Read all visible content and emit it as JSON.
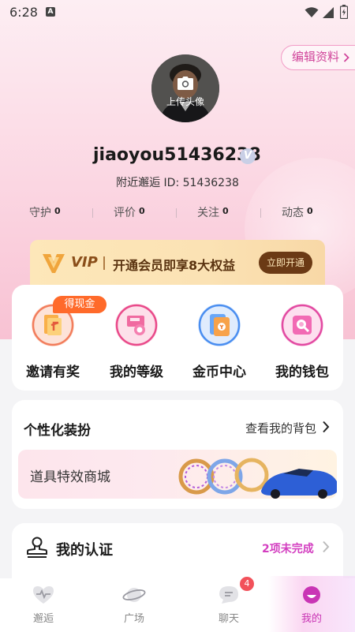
{
  "status_bar": {
    "time": "6:28",
    "app_badge": "A"
  },
  "header": {
    "edit_profile_label": "编辑资料"
  },
  "profile": {
    "avatar_label": "上传头像",
    "username": "jiaoyou51436238",
    "verified_badge": "V",
    "id_line": "附近邂逅 ID: 51436238"
  },
  "stats": [
    {
      "label": "守护",
      "value": "0"
    },
    {
      "label": "评价",
      "value": "0"
    },
    {
      "label": "关注",
      "value": "0"
    },
    {
      "label": "动态",
      "value": "0"
    }
  ],
  "vip": {
    "badge": "VIP",
    "description": "开通会员即享8大权益",
    "button": "立即开通"
  },
  "features": {
    "cash_tag": "得现金",
    "items": [
      {
        "label": "邀请有奖",
        "icon": "invite-gift-icon"
      },
      {
        "label": "我的等级",
        "icon": "level-medal-icon"
      },
      {
        "label": "金币中心",
        "icon": "coin-wallet-icon"
      },
      {
        "label": "我的钱包",
        "icon": "wallet-search-icon"
      }
    ]
  },
  "dressup": {
    "title": "个性化装扮",
    "link": "查看我的背包",
    "banner_text": "道具特效商城"
  },
  "certification": {
    "title": "我的认证",
    "status": "2项未完成"
  },
  "bottom_nav": {
    "items": [
      {
        "label": "邂逅",
        "icon": "heart-pulse-icon"
      },
      {
        "label": "广场",
        "icon": "planet-icon"
      },
      {
        "label": "聊天",
        "icon": "chat-bubble-icon",
        "badge": "4"
      },
      {
        "label": "我的",
        "icon": "profile-face-icon"
      }
    ],
    "active_index": 3
  },
  "colors": {
    "accent": "#c935b5",
    "vip_brown": "#6b3a15",
    "badge_red": "#f2515a",
    "cash_orange": "#ff6a2a"
  }
}
